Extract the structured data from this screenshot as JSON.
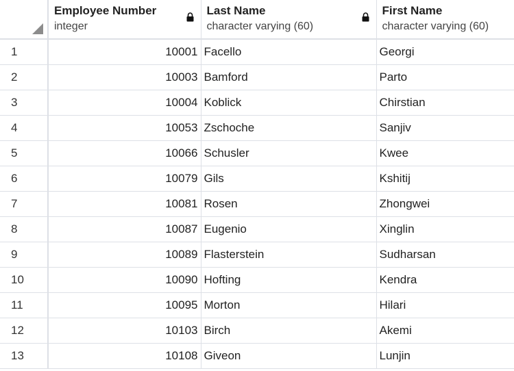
{
  "columns": [
    {
      "name": "Employee Number",
      "type": "integer",
      "locked": true
    },
    {
      "name": "Last Name",
      "type": "character varying (60)",
      "locked": true
    },
    {
      "name": "First Name",
      "type": "character varying (60)",
      "locked": false
    }
  ],
  "rows": [
    {
      "n": "1",
      "emp_no": "10001",
      "last_name": "Facello",
      "first_name": "Georgi"
    },
    {
      "n": "2",
      "emp_no": "10003",
      "last_name": "Bamford",
      "first_name": "Parto"
    },
    {
      "n": "3",
      "emp_no": "10004",
      "last_name": "Koblick",
      "first_name": "Chirstian"
    },
    {
      "n": "4",
      "emp_no": "10053",
      "last_name": "Zschoche",
      "first_name": "Sanjiv"
    },
    {
      "n": "5",
      "emp_no": "10066",
      "last_name": "Schusler",
      "first_name": "Kwee"
    },
    {
      "n": "6",
      "emp_no": "10079",
      "last_name": "Gils",
      "first_name": "Kshitij"
    },
    {
      "n": "7",
      "emp_no": "10081",
      "last_name": "Rosen",
      "first_name": "Zhongwei"
    },
    {
      "n": "8",
      "emp_no": "10087",
      "last_name": "Eugenio",
      "first_name": "Xinglin"
    },
    {
      "n": "9",
      "emp_no": "10089",
      "last_name": "Flasterstein",
      "first_name": "Sudharsan"
    },
    {
      "n": "10",
      "emp_no": "10090",
      "last_name": "Hofting",
      "first_name": "Kendra"
    },
    {
      "n": "11",
      "emp_no": "10095",
      "last_name": "Morton",
      "first_name": "Hilari"
    },
    {
      "n": "12",
      "emp_no": "10103",
      "last_name": "Birch",
      "first_name": "Akemi"
    },
    {
      "n": "13",
      "emp_no": "10108",
      "last_name": "Giveon",
      "first_name": "Lunjin"
    }
  ]
}
